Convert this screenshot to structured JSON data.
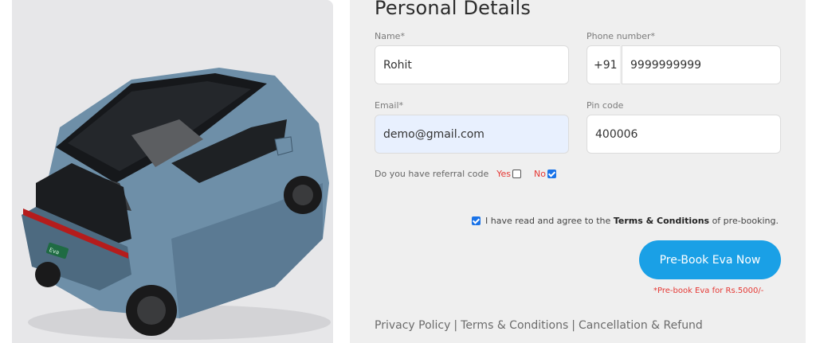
{
  "car_image": {
    "badge_text": "Eva"
  },
  "form": {
    "title": "Personal Details",
    "name": {
      "label": "Name*",
      "value": "Rohit"
    },
    "phone": {
      "label": "Phone number*",
      "prefix": "+91",
      "value": "9999999999"
    },
    "email": {
      "label": "Email*",
      "value": "demo@gmail.com"
    },
    "pincode": {
      "label": "Pin code",
      "value": "400006"
    },
    "referral": {
      "question": "Do you have referral code",
      "yes_label": "Yes",
      "yes_checked": false,
      "no_label": "No",
      "no_checked": true
    },
    "terms": {
      "prefix": "I have read and agree to the",
      "link": "Terms & Conditions",
      "suffix": "of pre-booking.",
      "checked": true
    },
    "submit_label": "Pre-Book Eva Now",
    "note": "*Pre-book Eva for Rs.5000/-"
  },
  "footer": {
    "links": [
      "Privacy Policy",
      "Terms & Conditions",
      "Cancellation & Refund"
    ],
    "separator": "|"
  },
  "colors": {
    "accent": "#1aa0e6",
    "error": "#e53935",
    "car_body": "#6e8fa8"
  }
}
